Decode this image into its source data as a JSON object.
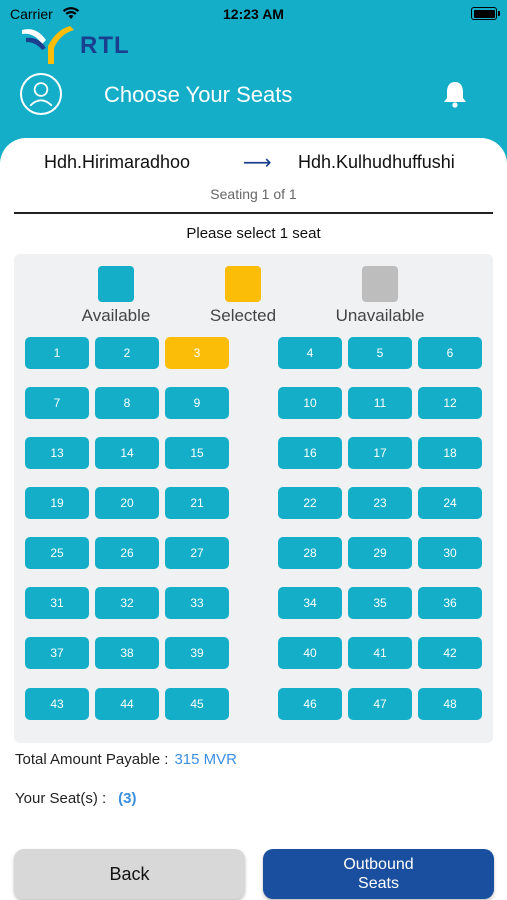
{
  "status_bar": {
    "carrier": "Carrier",
    "time": "12:23 AM"
  },
  "header": {
    "logo_text": "RTL",
    "title": "Choose Your Seats",
    "icons": [
      "avatar-icon",
      "bell-icon"
    ]
  },
  "route": {
    "from": "Hdh.Hirimaradhoo",
    "arrow": "⟶",
    "to": "Hdh.Kulhudhuffushi",
    "seating": "Seating 1 of 1"
  },
  "instruction": "Please select 1 seat",
  "legend": {
    "available": "Available",
    "selected": "Selected",
    "unavailable": "Unavailable"
  },
  "colors": {
    "brand": "#14aec8",
    "available": "#14aec8",
    "selected": "#fbbd08",
    "unavailable": "#bdbdbd",
    "primary_button": "#1a4f9f",
    "link": "#3b8fe0"
  },
  "seats": [
    "1",
    "2",
    "3",
    "4",
    "5",
    "6",
    "7",
    "8",
    "9",
    "10",
    "11",
    "12",
    "13",
    "14",
    "15",
    "16",
    "17",
    "18",
    "19",
    "20",
    "21",
    "22",
    "23",
    "24",
    "25",
    "26",
    "27",
    "28",
    "29",
    "30",
    "31",
    "32",
    "33",
    "34",
    "35",
    "36",
    "37",
    "38",
    "39",
    "40",
    "41",
    "42",
    "43",
    "44",
    "45",
    "46",
    "47",
    "48"
  ],
  "selected_seat": "3",
  "summary": {
    "total_label": "Total Amount Payable :",
    "total_value": "315 MVR",
    "seats_label": "Your Seat(s) :",
    "seats_value": "(3)"
  },
  "buttons": {
    "back": "Back",
    "outbound": "Outbound Seats"
  }
}
